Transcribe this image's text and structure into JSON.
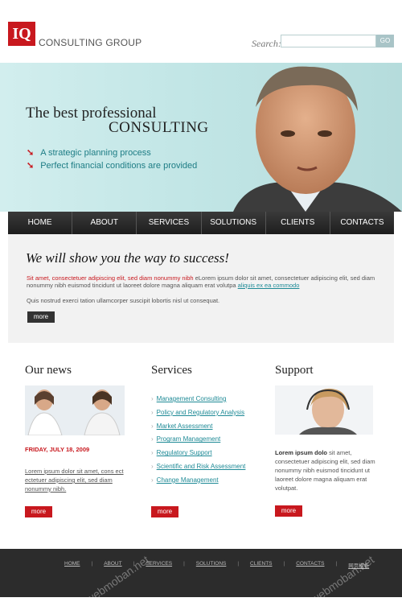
{
  "brand": {
    "logo": "IQ",
    "name": "CONSULTING GROUP"
  },
  "search": {
    "label": "Search:",
    "placeholder": "",
    "button": "GO"
  },
  "banner": {
    "line1": "The best professional",
    "line2": "CONSULTING",
    "bullets": [
      "A strategic planning process",
      "Perfect financial conditions are provided"
    ]
  },
  "nav": [
    "HOME",
    "ABOUT",
    "SERVICES",
    "SOLUTIONS",
    "CLIENTS",
    "CONTACTS"
  ],
  "intro": {
    "heading": "We will show you the way to success!",
    "lead_red": "Sit amet, consectetuer adipiscing elit, sed diam nonummy nibh",
    "lead_rest": " eLorem ipsum dolor sit amet, consectetuer adipiscing elit, sed diam nonummy nibh euismod tincidunt ut laoreet dolore magna aliquam erat volutpa",
    "lead_link": "aliquis ex ea commodo",
    "second": "Quis nostrud exerci tation ullamcorper suscipit lobortis nisl ut consequat.",
    "more": "more"
  },
  "news": {
    "title": "Our news",
    "date": "FRIDAY, JULY 18, 2009",
    "text": "Lorem ipsum dolor sit amet, cons ect ectetuer adipiscing elit, sed diam nonummy nibh.",
    "more": "more"
  },
  "services": {
    "title": "Services",
    "items": [
      "Management Consulting",
      "Policy and Regulatory Analysis",
      "Market Assessment",
      "Program Management",
      "Regulatory Support",
      "Scientific and Risk Assessment",
      "Change Management"
    ],
    "more": "more"
  },
  "support": {
    "title": "Support",
    "bold": "Lorem ipsum dolo",
    "text": " sit amet, consectetuer adipiscing elit, sed diam nonummy nibh euismod tincidunt ut laoreet dolore magna aliquam erat volutpat.",
    "more": "more"
  },
  "footer": {
    "links": [
      "HOME",
      "ABOUT",
      "SERVICES",
      "SOLUTIONS",
      "CLIENTS",
      "CONTACTS",
      "网页模板"
    ],
    "watermark": "webmoban.net"
  },
  "colors": {
    "accent": "#c8181e",
    "link": "#1e8a96",
    "nav": "#2a2a2a"
  }
}
